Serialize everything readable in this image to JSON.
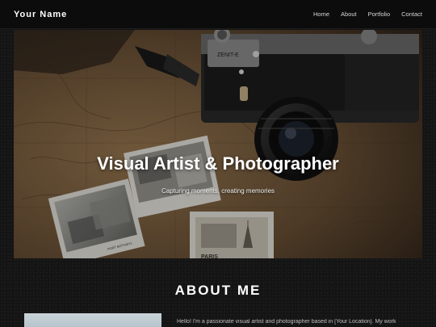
{
  "nav": {
    "brand": "Your Name",
    "links": [
      "Home",
      "About",
      "Portfolio",
      "Contact"
    ]
  },
  "hero": {
    "title": "Visual Artist & Photographer",
    "subtitle": "Capturing moments, creating memories",
    "camera_brand": "ZENIT-E",
    "postcard_top_text": "PORT BOTHWYL",
    "postcard_bottom_text": "PARIS"
  },
  "about": {
    "heading": "ABOUT ME",
    "intro": "Hello! I'm a passionate visual artist and photographer based in [Your Location]. My work"
  },
  "colors": {
    "background": "#141414",
    "navbar": "#0c0c0c",
    "text": "#ffffff",
    "muted_text": "#bdbdbd"
  }
}
